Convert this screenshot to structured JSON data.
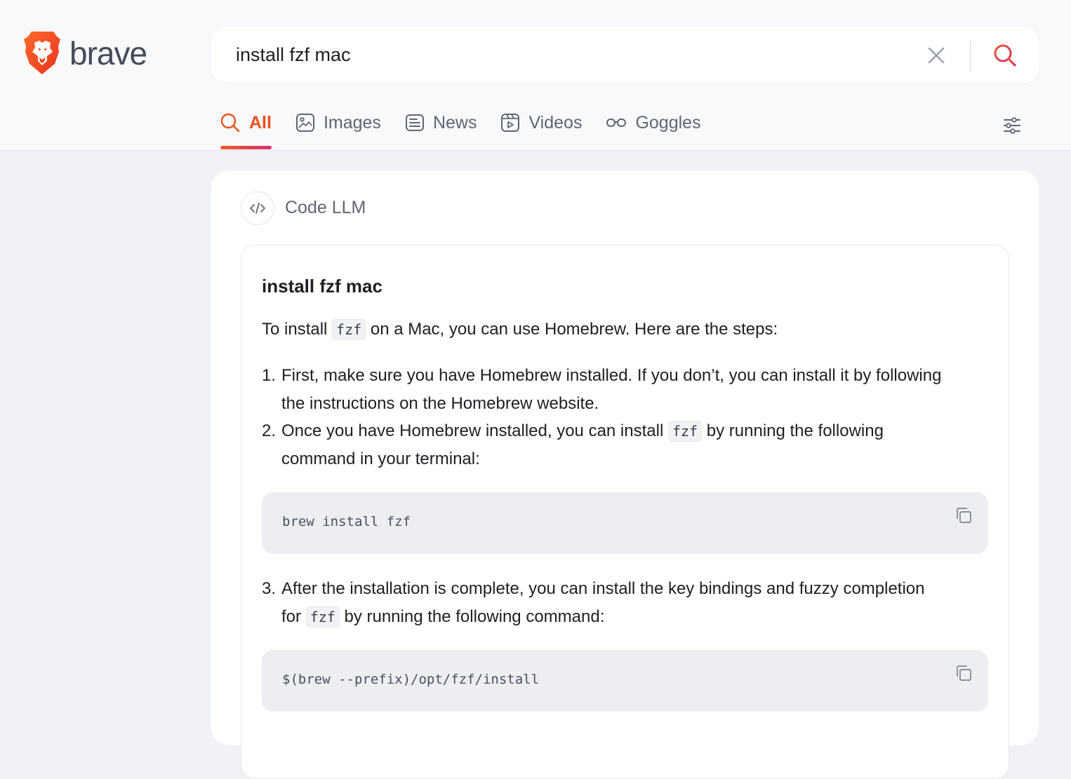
{
  "brand": {
    "name": "brave",
    "logo_icon": "brave-lion-icon",
    "accent": "#ed4f22"
  },
  "search": {
    "query": "install fzf mac"
  },
  "tabs": [
    {
      "label": "All",
      "icon": "search-icon",
      "active": true
    },
    {
      "label": "Images",
      "icon": "image-icon"
    },
    {
      "label": "News",
      "icon": "news-icon"
    },
    {
      "label": "Videos",
      "icon": "video-icon"
    },
    {
      "label": "Goggles",
      "icon": "goggles-icon"
    }
  ],
  "panel": {
    "source_label": "Code LLM",
    "answer": {
      "title": "install fzf mac",
      "intro_before": "To install ",
      "intro_code": "fzf",
      "intro_after": " on a Mac, you can use Homebrew. Here are the steps:",
      "steps": [
        {
          "number": "1.",
          "line1": "First, make sure you have Homebrew installed. If you don’t, you can install it by following",
          "line2": "the instructions on the Homebrew website."
        },
        {
          "number": "2.",
          "line1_before": "Once you have Homebrew installed, you can install ",
          "line1_code": "fzf",
          "line1_after": " by running the following",
          "line2": "command in your terminal:",
          "code": "brew install fzf"
        },
        {
          "number": "3.",
          "line1": "After the installation is complete, you can install the key bindings and fuzzy completion",
          "line2_before": "for ",
          "line2_code": "fzf",
          "line2_after": " by running the following command:",
          "code": "$(brew --prefix)/opt/fzf/install"
        }
      ]
    }
  }
}
